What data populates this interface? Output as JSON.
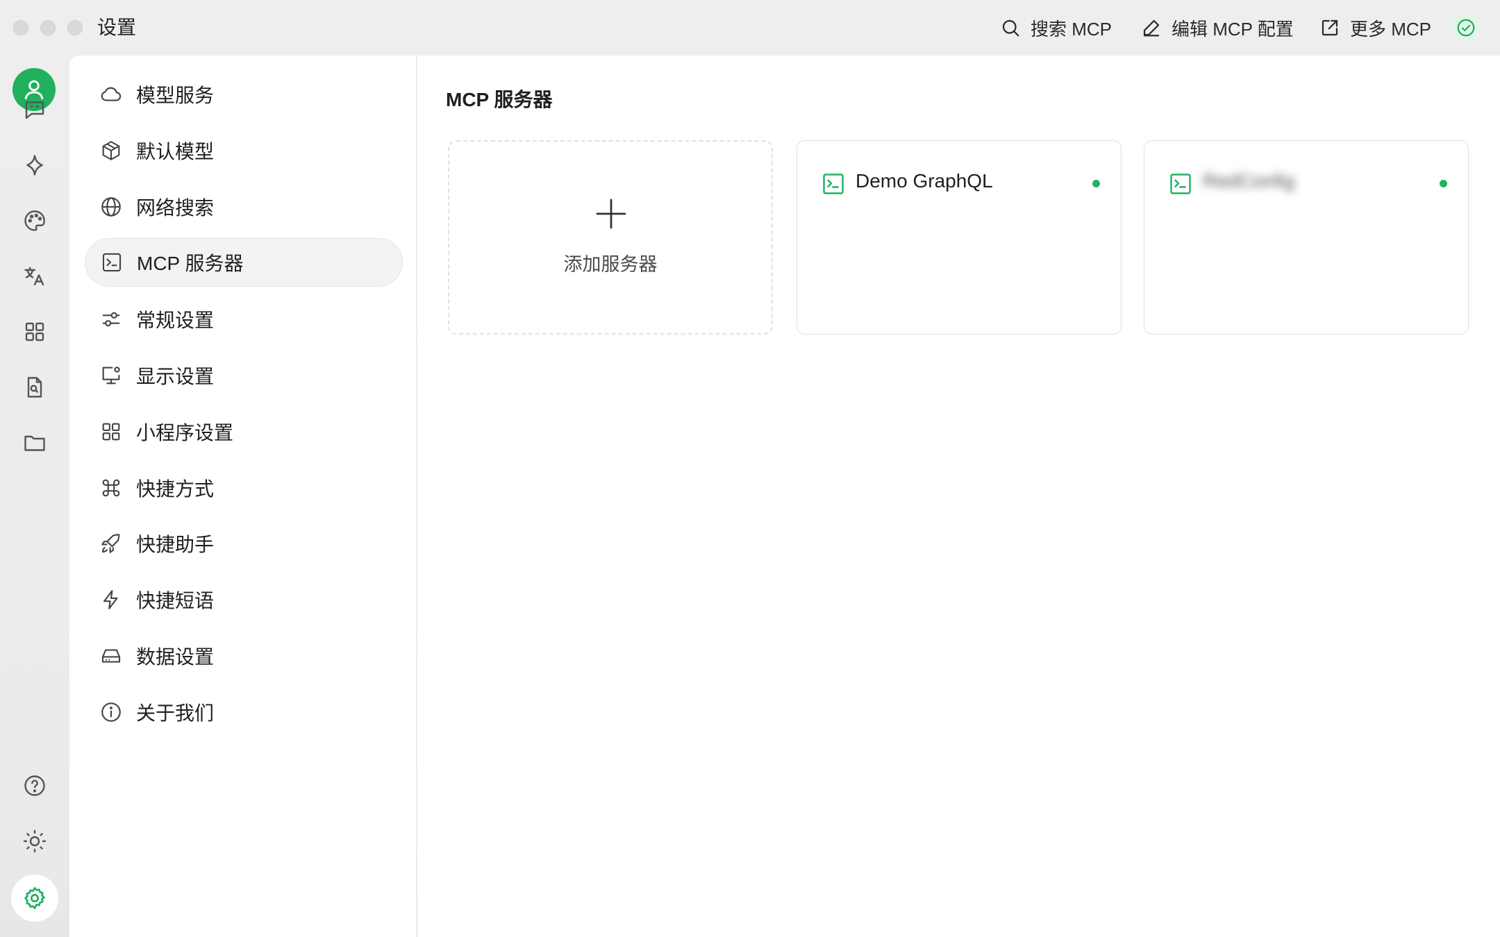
{
  "window": {
    "title": "设置"
  },
  "toolbar": {
    "search_label": "搜索 MCP",
    "edit_label": "编辑 MCP 配置",
    "more_label": "更多 MCP"
  },
  "settings_menu": [
    {
      "label": "模型服务",
      "icon": "cloud-icon"
    },
    {
      "label": "默认模型",
      "icon": "package-icon"
    },
    {
      "label": "网络搜索",
      "icon": "globe-icon"
    },
    {
      "label": "MCP 服务器",
      "icon": "terminal-icon",
      "active": true
    },
    {
      "label": "常规设置",
      "icon": "sliders-icon"
    },
    {
      "label": "显示设置",
      "icon": "monitor-cog-icon"
    },
    {
      "label": "小程序设置",
      "icon": "grid-icon"
    },
    {
      "label": "快捷方式",
      "icon": "command-icon"
    },
    {
      "label": "快捷助手",
      "icon": "rocket-icon"
    },
    {
      "label": "快捷短语",
      "icon": "zap-icon"
    },
    {
      "label": "数据设置",
      "icon": "hard-drive-icon"
    },
    {
      "label": "关于我们",
      "icon": "info-icon"
    }
  ],
  "content": {
    "title": "MCP 服务器",
    "add_card_label": "添加服务器",
    "servers": [
      {
        "name": "Demo GraphQL",
        "status": "active"
      },
      {
        "name": "RedConfig",
        "status": "active",
        "redacted": true
      }
    ]
  },
  "colors": {
    "accent": "#20b05e",
    "status_dot": "#22b35e"
  }
}
